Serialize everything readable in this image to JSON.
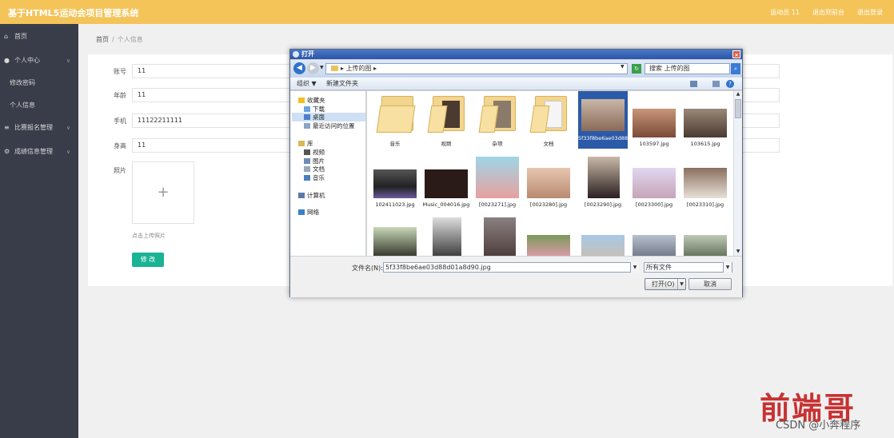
{
  "app": {
    "title": "基于HTML5运动会项目管理系统",
    "top_right": [
      "运动员 11",
      "退出到前台",
      "退出登录"
    ]
  },
  "sidebar": {
    "items": [
      {
        "icon": "home-icon",
        "label": "首页",
        "has_children": false
      },
      {
        "icon": "user-icon",
        "label": "个人中心",
        "has_children": true,
        "children": [
          "修改密码",
          "个人信息"
        ]
      },
      {
        "icon": "list-icon",
        "label": "比赛报名管理",
        "has_children": true
      },
      {
        "icon": "gear-icon",
        "label": "成绩信息管理",
        "has_children": true
      }
    ]
  },
  "breadcrumb": {
    "home": "首页",
    "separator": "/",
    "current": "个人信息"
  },
  "form": {
    "fields": [
      {
        "label": "账号",
        "value": "11"
      },
      {
        "label": "年龄",
        "value": "11"
      },
      {
        "label": "手机",
        "value": "11122211111"
      },
      {
        "label": "身高",
        "value": "11"
      }
    ],
    "photo_label": "照片",
    "upload_plus": "+",
    "upload_hint": "点击上传照片",
    "submit_label": "修 改"
  },
  "dialog": {
    "title": "打开",
    "close": "×",
    "address": "上传的图",
    "search_placeholder": "搜索 上传的图",
    "toolbar": {
      "organize": "组织 ▼",
      "new_folder": "新建文件夹"
    },
    "nav": {
      "favorites": "收藏夹",
      "favorite_items": [
        "下载",
        "桌面",
        "最近访问的位置"
      ],
      "libraries": "库",
      "library_items": [
        "视频",
        "图片",
        "文档",
        "音乐"
      ],
      "computer": "计算机",
      "network": "网络"
    },
    "files_row1": [
      {
        "name": "音乐",
        "kind": "folder"
      },
      {
        "name": "视频",
        "kind": "folder"
      },
      {
        "name": "杂项",
        "kind": "folder"
      },
      {
        "name": "文档",
        "kind": "folder"
      },
      {
        "name": "5f33f8be6ae03d88d01a8d90.jpg",
        "kind": "image",
        "selected": true
      },
      {
        "name": "103597.jpg",
        "kind": "image"
      },
      {
        "name": "103615.jpg",
        "kind": "image"
      }
    ],
    "files_row2": [
      {
        "name": "102411023.jpg",
        "kind": "image"
      },
      {
        "name": "Music_004016.jpg",
        "kind": "image"
      },
      {
        "name": "[0023271].jpg",
        "kind": "image"
      },
      {
        "name": "[0023280].jpg",
        "kind": "image"
      },
      {
        "name": "[0023290].jpg",
        "kind": "image"
      },
      {
        "name": "[0023300].jpg",
        "kind": "image"
      },
      {
        "name": "[0023310].jpg",
        "kind": "image"
      }
    ],
    "file_name_label": "文件名(N):",
    "file_name_value": "5f33f8be6ae03d88d01a8d90.jpg",
    "file_type": "所有文件",
    "open_label": "打开(O)",
    "cancel_label": "取消"
  },
  "watermark": {
    "text": "CSDN @小奔程序"
  }
}
